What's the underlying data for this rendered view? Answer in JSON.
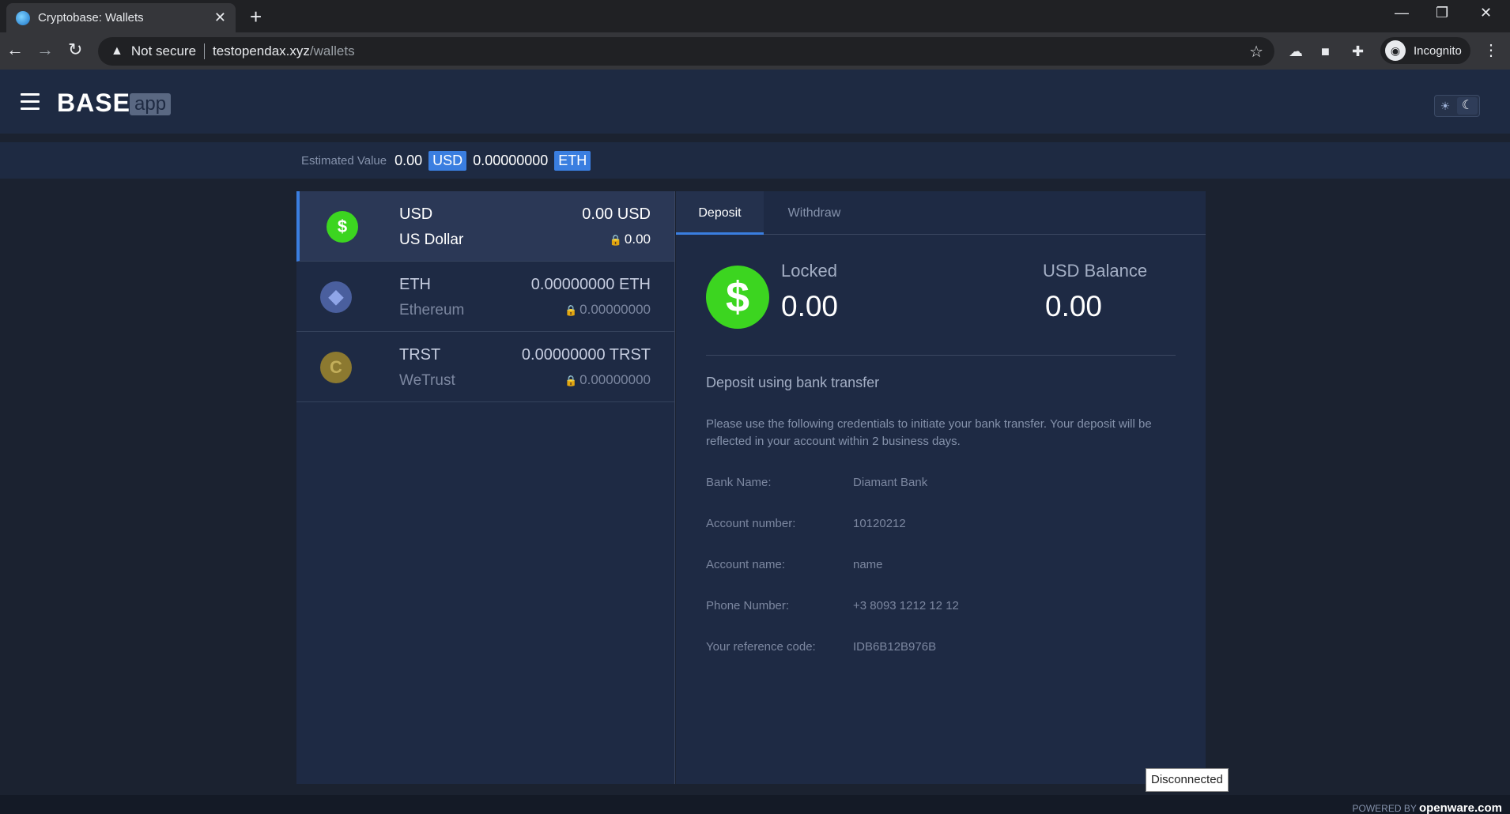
{
  "browser": {
    "tab_title": "Cryptobase: Wallets",
    "tab_close": "✕",
    "new_tab": "+",
    "not_secure": "Not secure",
    "url_host": "testopendax.xyz",
    "url_path": "/wallets",
    "profile_label": "Incognito"
  },
  "header": {
    "logo": "BASE",
    "logo_badge": "app"
  },
  "estimated": {
    "label": "Estimated Value",
    "usd_value": "0.00",
    "usd_badge": "USD",
    "eth_value": "0.00000000",
    "eth_badge": "ETH"
  },
  "wallets": [
    {
      "code": "USD",
      "name": "US Dollar",
      "balance": "0.00 USD",
      "locked": "0.00",
      "icon": "dollar-icon",
      "color": "#3cd520"
    },
    {
      "code": "ETH",
      "name": "Ethereum",
      "balance": "0.00000000 ETH",
      "locked": "0.00000000",
      "icon": "ethereum-icon",
      "color": "#4a5f9e"
    },
    {
      "code": "TRST",
      "name": "WeTrust",
      "balance": "0.00000000 TRST",
      "locked": "0.00000000",
      "icon": "wetrust-icon",
      "color": "#8c7930"
    }
  ],
  "detail": {
    "tabs": [
      "Deposit",
      "Withdraw"
    ],
    "locked_label": "Locked",
    "locked_value": "0.00",
    "balance_label": "USD Balance",
    "balance_value": "0.00",
    "heading": "Deposit using bank transfer",
    "description": "Please use the following credentials to initiate your bank transfer. Your deposit will be reflected in your account within 2 business days.",
    "bank_info": [
      {
        "label": "Bank Name:",
        "value": "Diamant Bank"
      },
      {
        "label": "Account number:",
        "value": "10120212"
      },
      {
        "label": "Account name:",
        "value": "name"
      },
      {
        "label": "Phone Number:",
        "value": "+3 8093 1212 12 12"
      },
      {
        "label": "Your reference code:",
        "value": "IDB6B12B976B"
      }
    ]
  },
  "footer": {
    "powered_prefix": "POWERED BY",
    "powered_brand": "openware.com"
  },
  "status": {
    "connection": "Disconnected"
  },
  "colors": {
    "accent": "#3a7ee0",
    "usd_green": "#3cd520",
    "panel": "#1e2a44",
    "background": "#1b2230"
  }
}
